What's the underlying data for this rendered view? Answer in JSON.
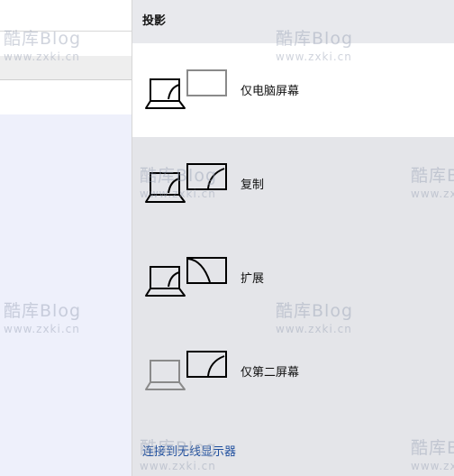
{
  "flyout": {
    "title": "投影",
    "options": [
      {
        "label": "仅电脑屏幕",
        "icon": "pc-screen-only-icon",
        "selected": true
      },
      {
        "label": "复制",
        "icon": "duplicate-icon",
        "selected": false
      },
      {
        "label": "扩展",
        "icon": "extend-icon",
        "selected": false
      },
      {
        "label": "仅第二屏幕",
        "icon": "second-screen-only-icon",
        "selected": false
      }
    ],
    "connect_link": "连接到无线显示器"
  },
  "watermark": {
    "brand": "酷库Blog",
    "url": "www.zxki.cn"
  },
  "colors": {
    "panel_bg": "#e4e5e9",
    "selected_bg": "#ffffff",
    "link": "#1f4f9e",
    "icon_stroke": "#000000",
    "icon_dim": "#8a8a8a"
  }
}
